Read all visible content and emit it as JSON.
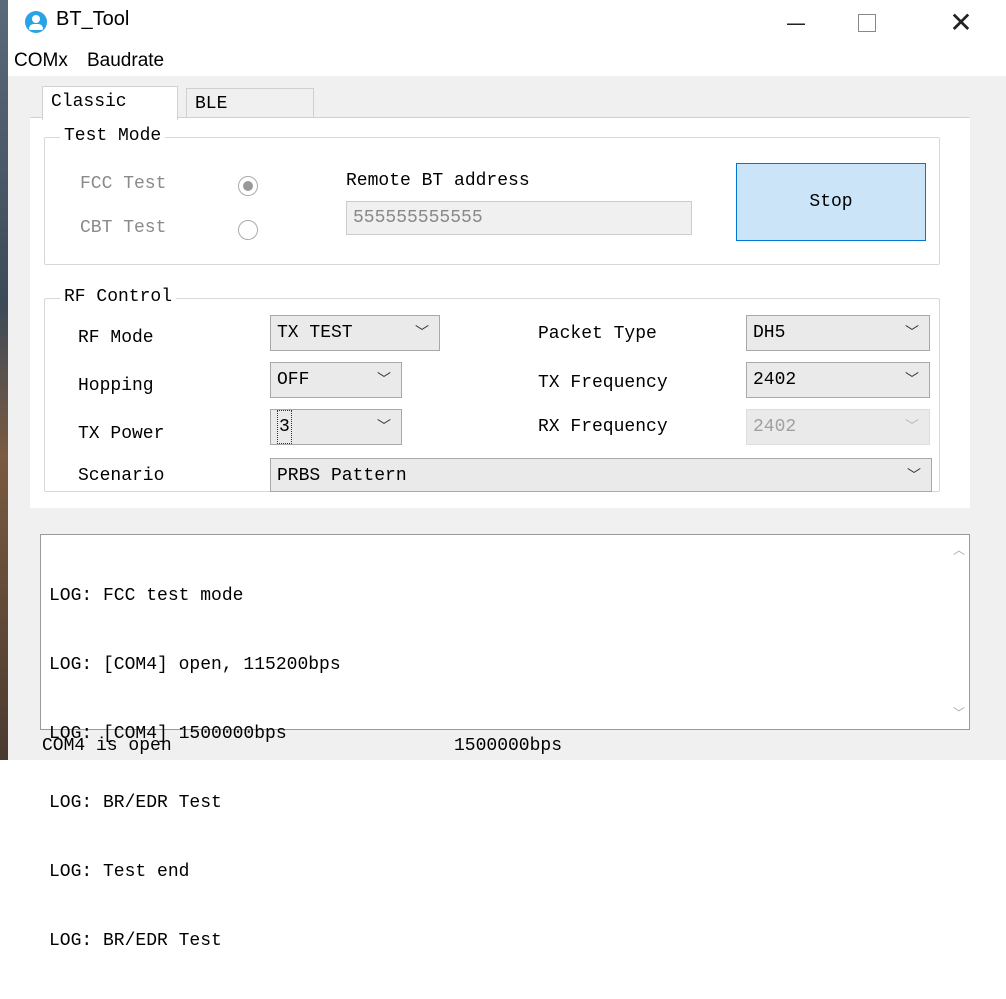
{
  "window": {
    "title": "BT_Tool",
    "minimize_glyph": "—",
    "close_glyph": "✕"
  },
  "menu": [
    "COMx",
    "Baudrate"
  ],
  "tabs": [
    "Classic",
    "BLE"
  ],
  "test_mode": {
    "legend": "Test Mode",
    "fcc_label": "FCC Test",
    "cbt_label": "CBT Test",
    "remote_label": "Remote BT address",
    "remote_value": "555555555555",
    "stop_label": "Stop"
  },
  "rf_control": {
    "legend": "RF Control",
    "rf_mode_label": "RF Mode",
    "rf_mode_value": "TX TEST",
    "hopping_label": "Hopping",
    "hopping_value": "OFF",
    "tx_power_label": "TX Power",
    "tx_power_value": "3",
    "scenario_label": "Scenario",
    "scenario_value": "PRBS Pattern",
    "packet_type_label": "Packet Type",
    "packet_type_value": "DH5",
    "tx_freq_label": "TX Frequency",
    "tx_freq_value": "2402",
    "rx_freq_label": "RX Frequency",
    "rx_freq_value": "2402"
  },
  "log": [
    "LOG: FCC test mode",
    "LOG: [COM4] open, 115200bps",
    "LOG: [COM4] 1500000bps",
    "LOG: BR/EDR Test",
    "LOG: Test end",
    "LOG: BR/EDR Test"
  ],
  "status": {
    "port": "COM4 is open",
    "baud": "1500000bps"
  },
  "colors": {
    "accent": "#0078d7",
    "button_fill": "#cce4f7",
    "app_icon": "#29a3e6"
  }
}
